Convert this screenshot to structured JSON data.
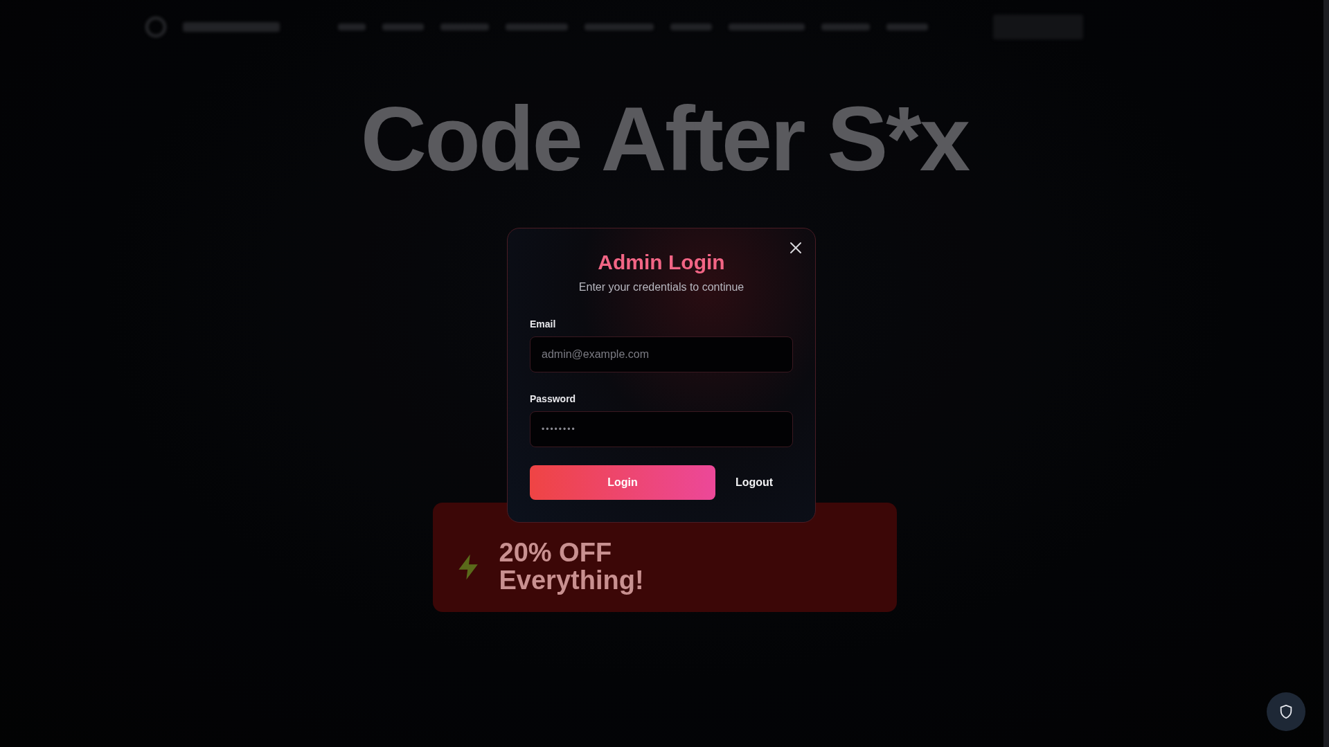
{
  "background": {
    "hero_title": "Code After S*x",
    "promo_title": "20% OFF Everything!"
  },
  "dialog": {
    "title": "Admin Login",
    "subtitle": "Enter your credentials to continue",
    "fields": [
      {
        "kind": "email",
        "label": "Email",
        "placeholder": "admin@example.com"
      },
      {
        "kind": "password",
        "label": "Password",
        "value": "••••••••"
      }
    ],
    "buttons": [
      {
        "kind": "primary",
        "label": "Login"
      },
      {
        "kind": "plain",
        "label": "Logout"
      }
    ]
  }
}
